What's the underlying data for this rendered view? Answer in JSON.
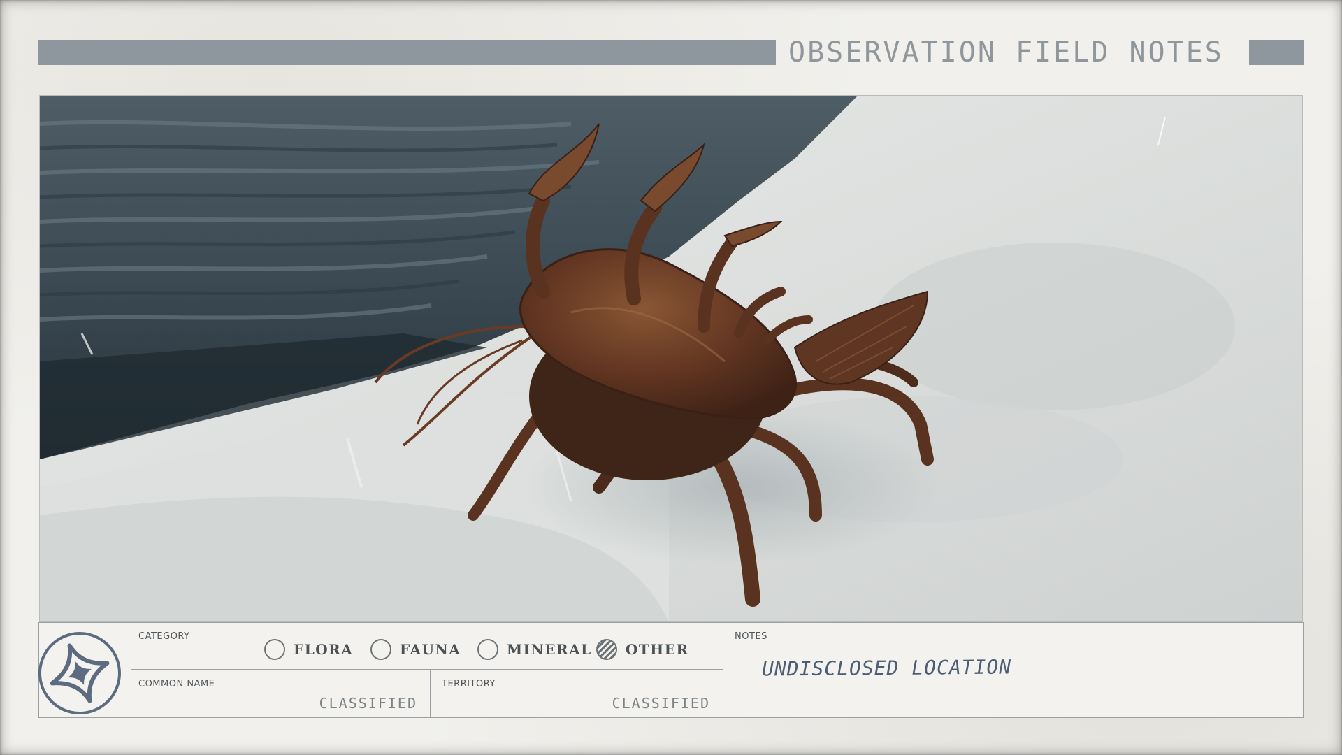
{
  "header": {
    "title": "OBSERVATION FIELD NOTES"
  },
  "photo": {
    "subject": "crab-like creature on snow beside rock"
  },
  "emblem": {
    "icon": "compass-star-icon"
  },
  "category": {
    "label": "CATEGORY",
    "options": [
      {
        "label": "FLORA",
        "selected": false
      },
      {
        "label": "FAUNA",
        "selected": false
      },
      {
        "label": "MINERAL",
        "selected": false
      },
      {
        "label": "OTHER",
        "selected": true
      }
    ]
  },
  "common_name": {
    "label": "COMMON NAME",
    "value": "CLASSIFIED"
  },
  "territory": {
    "label": "TERRITORY",
    "value": "CLASSIFIED"
  },
  "notes": {
    "label": "NOTES",
    "value": "UNDISCLOSED LOCATION"
  },
  "colors": {
    "paper": "#f1f0ec",
    "header_bar": "#8e979e",
    "ink": "#4d5d75",
    "creature": "#6b3a24"
  }
}
